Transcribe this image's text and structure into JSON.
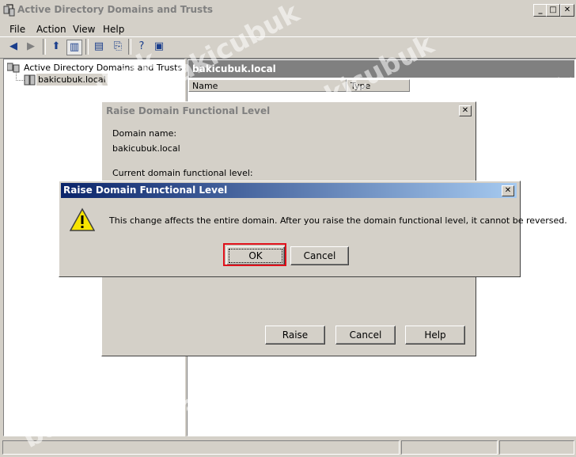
{
  "window": {
    "title": "Active Directory Domains and Trusts"
  },
  "menu": [
    "File",
    "Action",
    "View",
    "Help"
  ],
  "tree": {
    "root": "Active Directory Domains and Trusts",
    "child": "bakicubuk.local"
  },
  "right_pane": {
    "header": "bakicubuk.local",
    "columns": [
      "Name",
      "Type"
    ]
  },
  "bg_dialog": {
    "title": "Raise Domain Functional Level",
    "domain_name_label": "Domain name:",
    "domain_name_value": "bakicubuk.local",
    "current_level_label": "Current domain functional level:",
    "buttons": {
      "raise": "Raise",
      "cancel": "Cancel",
      "help": "Help"
    }
  },
  "fg_dialog": {
    "title": "Raise Domain Functional Level",
    "message": "This change affects the entire domain. After you raise the domain functional level, it cannot be reversed.",
    "buttons": {
      "ok": "OK",
      "cancel": "Cancel"
    }
  },
  "watermark": "bakicubuk",
  "colors": {
    "title_gradient_start": "#0a246a",
    "title_gradient_end": "#a6caf0",
    "highlight": "#e0101a",
    "warning": "#f7e400"
  }
}
